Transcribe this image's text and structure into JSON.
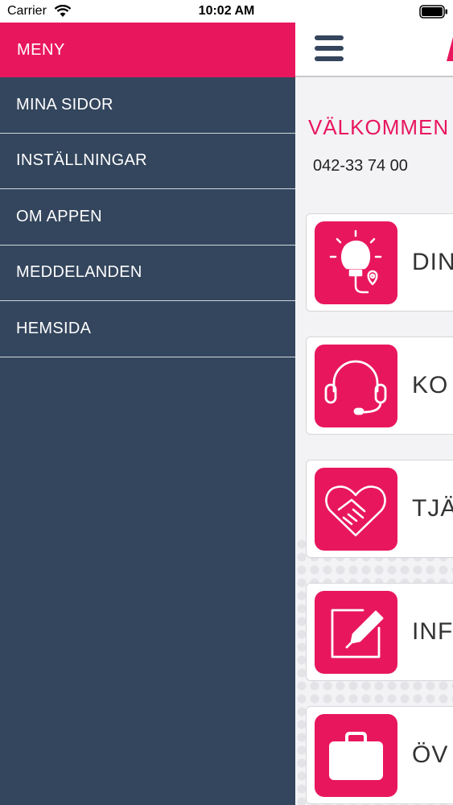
{
  "status_bar": {
    "carrier": "Carrier",
    "time": "10:02 AM"
  },
  "drawer": {
    "title": "MENY",
    "items": [
      {
        "label": "MINA SIDOR"
      },
      {
        "label": "INSTÄLLNINGAR"
      },
      {
        "label": "OM APPEN"
      },
      {
        "label": "MEDDELANDEN"
      },
      {
        "label": "HEMSIDA"
      }
    ]
  },
  "main": {
    "welcome": "VÄLKOMMEN",
    "phone": "042-33 74 00",
    "cards": [
      {
        "label": "DIN",
        "icon": "lightbulb-location-icon"
      },
      {
        "label": "KO",
        "icon": "headset-icon"
      },
      {
        "label": "TJÄ",
        "icon": "heart-handshake-icon"
      },
      {
        "label": "INF",
        "icon": "edit-pencil-icon"
      },
      {
        "label": "ÖV",
        "icon": "briefcase-icon"
      }
    ]
  },
  "colors": {
    "accent": "#e8175d",
    "drawer_bg": "#34465d",
    "divider": "#cfd5de"
  }
}
